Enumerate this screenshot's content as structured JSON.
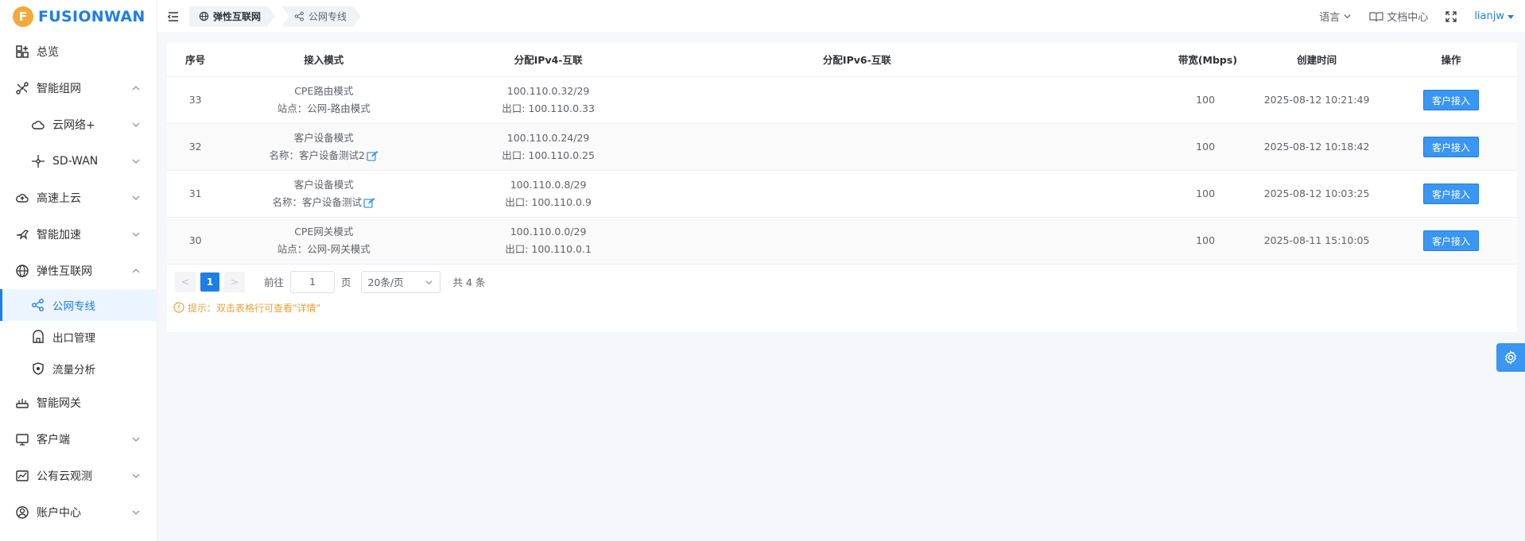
{
  "brand": {
    "logo_letter": "F",
    "name": "FUSIONWAN"
  },
  "sidebar": {
    "items": [
      {
        "label": "总览",
        "icon": "dashboard-icon"
      },
      {
        "label": "智能组网",
        "icon": "network-icon",
        "expanded": true
      },
      {
        "label": "云网络+",
        "icon": "cloud-icon"
      },
      {
        "label": "SD-WAN",
        "icon": "sdwan-icon"
      },
      {
        "label": "高速上云",
        "icon": "cloud-upload-icon"
      },
      {
        "label": "智能加速",
        "icon": "accelerate-icon"
      },
      {
        "label": "弹性互联网",
        "icon": "globe-icon",
        "expanded": true
      },
      {
        "label": "公网专线",
        "icon": "share-icon",
        "active": true
      },
      {
        "label": "出口管理",
        "icon": "gateway-icon"
      },
      {
        "label": "流量分析",
        "icon": "shield-icon"
      },
      {
        "label": "智能网关",
        "icon": "router-icon"
      },
      {
        "label": "客户端",
        "icon": "monitor-icon"
      },
      {
        "label": "公有云观测",
        "icon": "chart-icon"
      },
      {
        "label": "账户中心",
        "icon": "user-icon"
      }
    ]
  },
  "header": {
    "breadcrumb": [
      "弹性互联网",
      "公网专线"
    ],
    "language": "语言",
    "docs": "文档中心",
    "user": "lianjw"
  },
  "table": {
    "headers": [
      "序号",
      "接入模式",
      "分配IPv4-互联",
      "分配IPv6-互联",
      "带宽(Mbps)",
      "创建时间",
      "操作"
    ],
    "rows": [
      {
        "id": "33",
        "mode": "CPE路由模式",
        "mode_detail": "站点：公网-路由模式",
        "ipv4": "100.110.0.32/29",
        "egress": "出口: 100.110.0.33",
        "ipv6": "",
        "bandwidth": "100",
        "created": "2025-08-12 10:21:49",
        "action": "客户接入",
        "editable": false
      },
      {
        "id": "32",
        "mode": "客户设备模式",
        "mode_detail": "名称：客户设备测试2",
        "ipv4": "100.110.0.24/29",
        "egress": "出口: 100.110.0.25",
        "ipv6": "",
        "bandwidth": "100",
        "created": "2025-08-12 10:18:42",
        "action": "客户接入",
        "editable": true
      },
      {
        "id": "31",
        "mode": "客户设备模式",
        "mode_detail": "名称：客户设备测试",
        "ipv4": "100.110.0.8/29",
        "egress": "出口: 100.110.0.9",
        "ipv6": "",
        "bandwidth": "100",
        "created": "2025-08-12 10:03:25",
        "action": "客户接入",
        "editable": true
      },
      {
        "id": "30",
        "mode": "CPE网关模式",
        "mode_detail": "站点：公网-网关模式",
        "ipv4": "100.110.0.0/29",
        "egress": "出口: 100.110.0.1",
        "ipv6": "",
        "bandwidth": "100",
        "created": "2025-08-11 15:10:05",
        "action": "客户接入",
        "editable": false
      }
    ]
  },
  "pager": {
    "prev": "<",
    "current": "1",
    "next": ">",
    "goto_label": "前往",
    "goto_value": "1",
    "page_unit": "页",
    "page_size": "20条/页",
    "total": "共 4 条"
  },
  "tip": "提示：双击表格行可查看\"详情\"",
  "colors": {
    "primary": "#1e7ee4",
    "warning": "#e6a23c",
    "logo": "#f2a93b"
  }
}
